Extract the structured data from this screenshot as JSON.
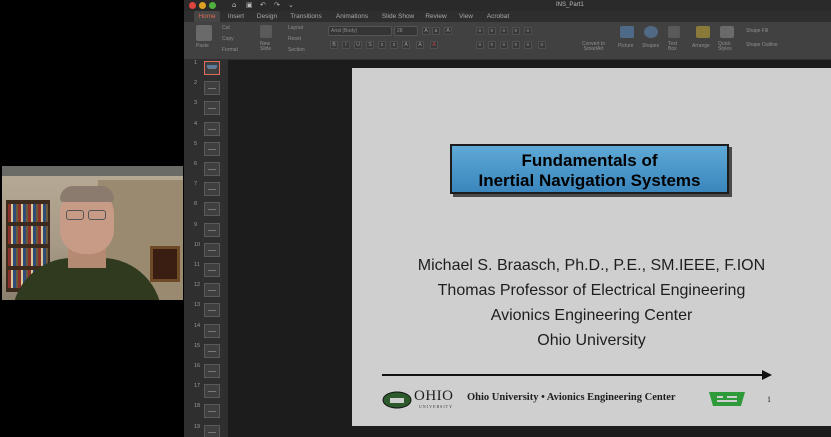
{
  "window": {
    "title": "INS_Part1"
  },
  "ribbon": {
    "tabs": [
      "Home",
      "Insert",
      "Design",
      "Transitions",
      "Animations",
      "Slide Show",
      "Review",
      "View",
      "Acrobat"
    ],
    "active_tab": "Home",
    "paste_label": "Paste",
    "cut_label": "Cut",
    "copy_label": "Copy",
    "format_label": "Format",
    "new_slide_label": "New\nSlide",
    "layout_label": "Layout",
    "reset_label": "Reset",
    "section_label": "Section",
    "font_name": "Arial (Body)",
    "font_size": "28",
    "convert_label": "Convert to\nSmartArt",
    "picture_label": "Picture",
    "shapes_label": "Shapes",
    "textbox_label": "Text\nBox",
    "arrange_label": "Arrange",
    "quick_styles_label": "Quick\nStyles",
    "shape_fill_label": "Shape Fill",
    "shape_outline_label": "Shape Outline"
  },
  "slides_pane": {
    "numbers": [
      "1",
      "2",
      "3",
      "4",
      "5",
      "6",
      "7",
      "8",
      "9",
      "10",
      "11",
      "12",
      "13",
      "14",
      "15",
      "16",
      "17",
      "18",
      "19"
    ]
  },
  "slide": {
    "title_line1": "Fundamentals of",
    "title_line2": "Inertial Navigation Systems",
    "author": "Michael S. Braasch, Ph.D., P.E., SM.IEEE, F.ION",
    "position": "Thomas Professor of Electrical Engineering",
    "center": "Avionics Engineering Center",
    "university": "Ohio University",
    "footer_logo_word": "OHIO",
    "footer_logo_sub": "UNIVERSITY",
    "footer_text": "Ohio University • Avionics Engineering Center",
    "slide_number": "1"
  },
  "colors": {
    "accent_tab": "#e06b58",
    "title_box": "#3a86bd",
    "aec_logo": "#2e9a3a"
  }
}
